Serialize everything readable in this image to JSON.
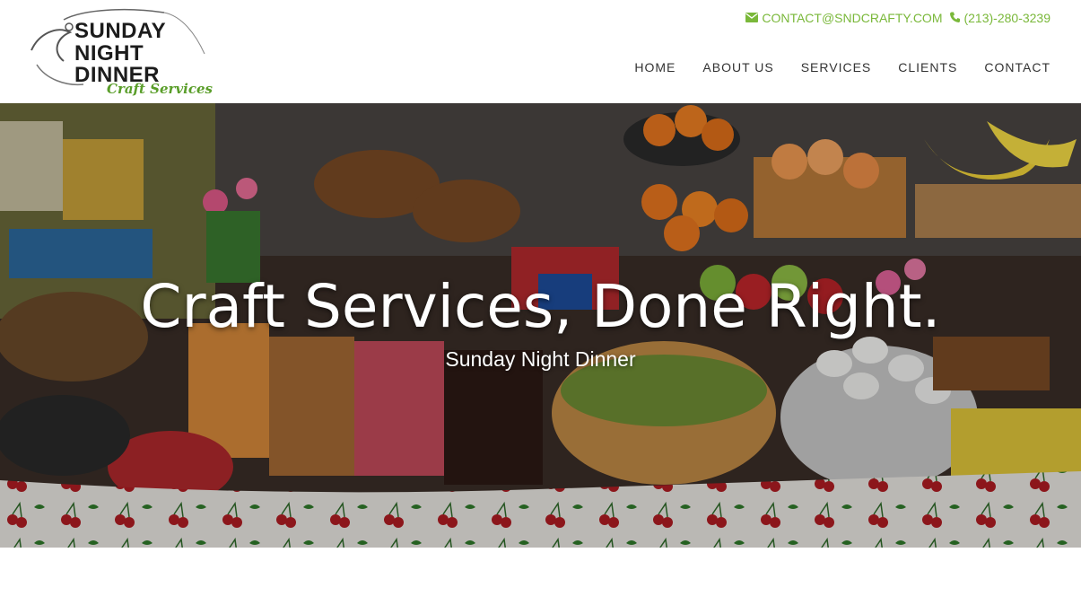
{
  "brand": {
    "logo_line1": "SUNDAY",
    "logo_line2": "NIGHT",
    "logo_line3": "DINNER",
    "logo_script": "Craft Services"
  },
  "contact": {
    "email": "CONTACT@SNDCRAFTY.COM",
    "phone": "(213)-280-3239",
    "email_icon": "envelope-icon",
    "phone_icon": "phone-icon"
  },
  "nav": {
    "items": [
      {
        "label": "HOME"
      },
      {
        "label": "ABOUT US"
      },
      {
        "label": "SERVICES"
      },
      {
        "label": "CLIENTS"
      },
      {
        "label": "CONTACT"
      }
    ]
  },
  "hero": {
    "title": "Craft Services, Done Right.",
    "subtitle": "Sunday Night Dinner"
  },
  "colors": {
    "accent": "#7ab83a",
    "nav_text": "#333333"
  }
}
